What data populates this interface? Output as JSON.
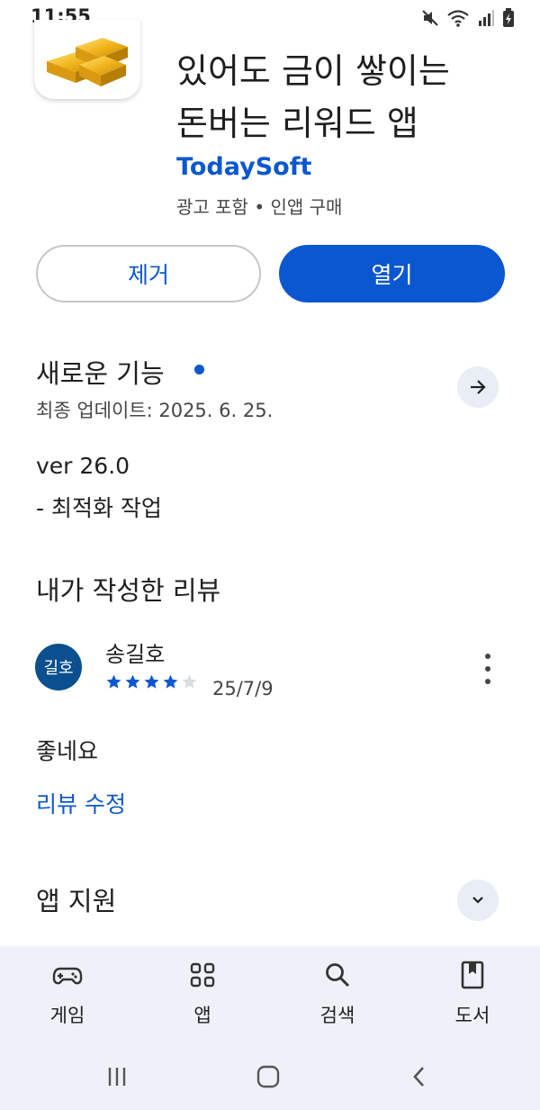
{
  "status_bar": {
    "time": "11:55"
  },
  "app": {
    "title_line1": "있어도 금이 쌓이는",
    "title_line2": "돈버는 리워드 앱",
    "developer": "TodaySoft",
    "meta": "광고 포함 • 인앱 구매",
    "remove_label": "제거",
    "open_label": "열기"
  },
  "whats_new": {
    "title": "새로운 기능",
    "updated": "최종 업데이트: 2025. 6. 25.",
    "version": "ver 26.0",
    "note": "- 최적화 작업"
  },
  "my_review": {
    "title": "내가 작성한 리뷰",
    "avatar_text": "길호",
    "reviewer": "송길호",
    "rating": 4,
    "max_rating": 5,
    "date": "25/7/9",
    "text": "좋네요",
    "edit_label": "리뷰 수정"
  },
  "app_support": {
    "title": "앱 지원"
  },
  "bottom_nav": {
    "items": [
      {
        "label": "게임",
        "icon": "gamepad-icon"
      },
      {
        "label": "앱",
        "icon": "apps-grid-icon"
      },
      {
        "label": "검색",
        "icon": "search-icon"
      },
      {
        "label": "도서",
        "icon": "book-icon"
      }
    ]
  },
  "colors": {
    "accent": "#0b57d0",
    "nav_background": "#eef2f8",
    "star_empty": "#dadce0"
  }
}
